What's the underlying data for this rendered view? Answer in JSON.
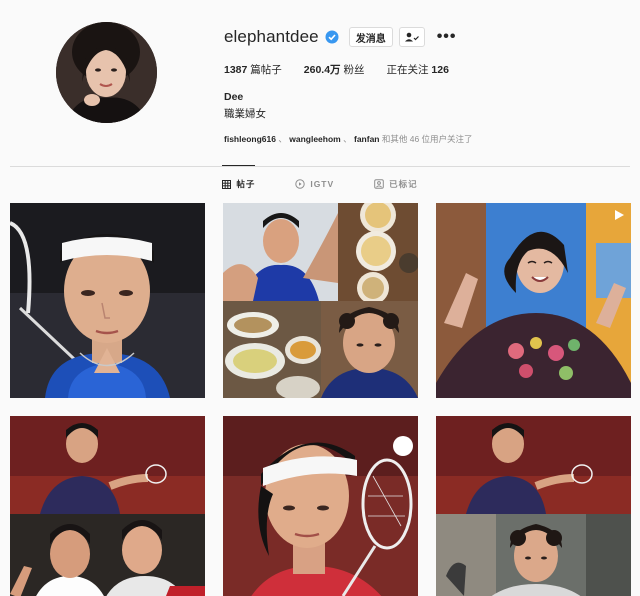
{
  "profile": {
    "username": "elephantdee",
    "verified": true,
    "message_button": "发消息",
    "stats": {
      "posts_count": "1387",
      "posts_label": "篇帖子",
      "followers_count": "260.4万",
      "followers_label": "粉丝",
      "following_label": "正在关注",
      "following_count": "126"
    },
    "full_name": "Dee",
    "bio": "職業婦女",
    "followed_by": {
      "names": [
        "fishleong616",
        "wangleehom",
        "fanfan"
      ],
      "separator": "、",
      "suffix": "和其他 46 位用户关注了"
    }
  },
  "tabs": [
    {
      "label": "帖子",
      "icon": "grid-icon",
      "active": true
    },
    {
      "label": "IGTV",
      "icon": "igtv-icon",
      "active": false
    },
    {
      "label": "已标记",
      "icon": "tagged-icon",
      "active": false
    }
  ],
  "posts": [
    {
      "subject": "badminton player with white headband and racket",
      "type": "image"
    },
    {
      "subject": "collage: gymnast, food bowls, dinner plates, curly hair athlete",
      "type": "image"
    },
    {
      "subject": "woman dancing in floral sweater",
      "type": "video"
    },
    {
      "subject": "collage: badminton players celebrating, TOKYO 2020",
      "type": "image"
    },
    {
      "subject": "badminton player with headband and racket, close-up",
      "type": "image"
    },
    {
      "subject": "collage: badminton player, curly hair athlete",
      "type": "image"
    }
  ],
  "colors": {
    "background": "#fafafa",
    "text": "#262626",
    "muted": "#8e8e8e",
    "verified_blue": "#3897f0",
    "border": "#dbdbdb"
  }
}
